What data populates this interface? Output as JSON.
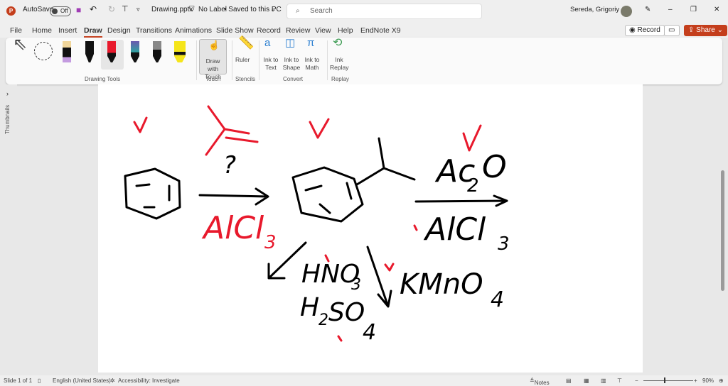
{
  "titlebar": {
    "app_icon": "powerpoint-icon",
    "autosave_label": "AutoSave",
    "autosave_state": "Off",
    "filename": "Drawing.pptx",
    "label_status": "No Label",
    "save_status": "• Saved to this PC",
    "search_placeholder": "Search",
    "user": "Sereda, Grigoriy A"
  },
  "menu": {
    "tabs": [
      "File",
      "Home",
      "Insert",
      "Draw",
      "Design",
      "Transitions",
      "Animations",
      "Slide Show",
      "Record",
      "Review",
      "View",
      "Help",
      "EndNote X9"
    ],
    "active": "Draw",
    "record": "Record",
    "share": "Share"
  },
  "ribbon": {
    "groups": {
      "drawing_tools": "Drawing Tools",
      "touch": "Touch",
      "stencils": "Stencils",
      "convert": "Convert",
      "replay": "Replay"
    },
    "buttons": {
      "draw_with_touch": "Draw with Touch",
      "ruler": "Ruler",
      "ink_to_text": "Ink to Text",
      "ink_to_shape": "Ink to Shape",
      "ink_to_math": "Ink to Math",
      "ink_replay": "Ink Replay"
    }
  },
  "sidebar": {
    "label": "Thumbnails"
  },
  "slide": {
    "ink": {
      "question": "?",
      "catalyst1": "AlCl",
      "catalyst1_sub": "3",
      "reagent2": "Ac",
      "reagent2_sub": "2",
      "reagent2_end": "O",
      "catalyst2": "AlCl",
      "catalyst2_sub": "3",
      "nitric": "HNO",
      "nitric_sub": "3",
      "sulfuric_h": "H",
      "sulfuric_sub2": "2",
      "sulfuric_so": "SO",
      "sulfuric_sub4": "4",
      "permanganate": "KMnO",
      "permanganate_sub": "4"
    },
    "colors": {
      "red": "#e8192c",
      "black": "#000000"
    }
  },
  "status": {
    "slide": "Slide 1 of 1",
    "language": "English (United States)",
    "accessibility": "Accessibility: Investigate",
    "notes": "Notes",
    "zoom": "90%"
  }
}
